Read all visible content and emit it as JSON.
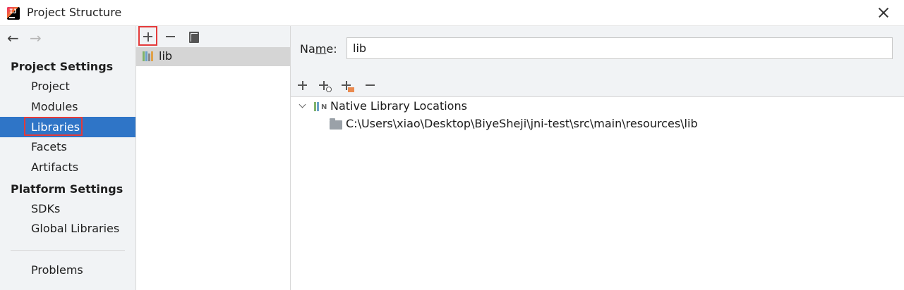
{
  "window": {
    "title": "Project Structure"
  },
  "sidebar": {
    "back_label": "←",
    "forward_label": "→",
    "project_settings_header": "Project Settings",
    "project_items": [
      "Project",
      "Modules",
      "Libraries",
      "Facets",
      "Artifacts"
    ],
    "platform_settings_header": "Platform Settings",
    "platform_items": [
      "SDKs",
      "Global Libraries"
    ],
    "problems_label": "Problems",
    "selected_item": "Libraries"
  },
  "libraries_list": {
    "items": [
      {
        "label": "lib"
      }
    ]
  },
  "detail": {
    "name_label_prefix": "Na",
    "name_label_mnemonic": "m",
    "name_label_suffix": "e:",
    "name_value": "lib",
    "tree": {
      "root_label": "Native Library Locations",
      "children": [
        "C:\\Users\\xiao\\Desktop\\BiyeSheji\\jni-test\\src\\main\\resources\\lib"
      ]
    }
  },
  "colors": {
    "selection": "#2f75c7",
    "highlight_box": "#e43a3a",
    "panel_bg": "#f1f3f5"
  }
}
